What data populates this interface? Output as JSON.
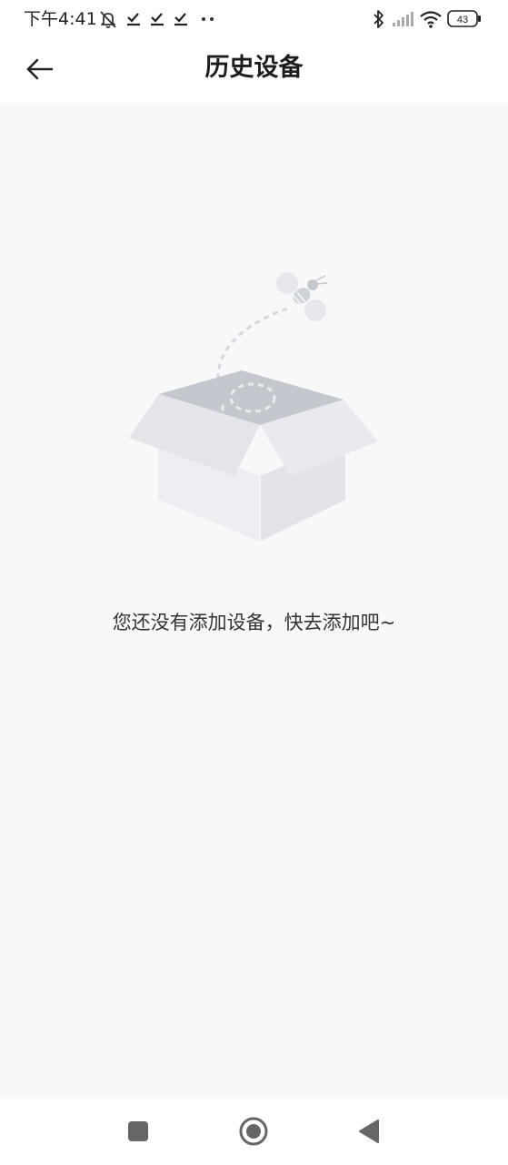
{
  "status_bar": {
    "time": "下午4:41",
    "battery_level": "43",
    "icons": [
      "mute-notification-icon",
      "check-download-icon",
      "check-download-icon",
      "check-download-icon",
      "more-dots-icon",
      "bluetooth-icon",
      "signal-icon",
      "wifi-icon",
      "battery-icon"
    ]
  },
  "header": {
    "title": "历史设备",
    "back_icon": "arrow-left-icon"
  },
  "empty_state": {
    "illustration": "open-box-with-bee",
    "message": "您还没有添加设备，快去添加吧~"
  },
  "nav_bar": {
    "buttons": [
      "recents-square-icon",
      "home-circle-icon",
      "back-triangle-icon"
    ]
  },
  "colors": {
    "background": "#f8f8f8",
    "surface": "#ffffff",
    "text": "#333333",
    "illustration": "#e4e6ea"
  }
}
